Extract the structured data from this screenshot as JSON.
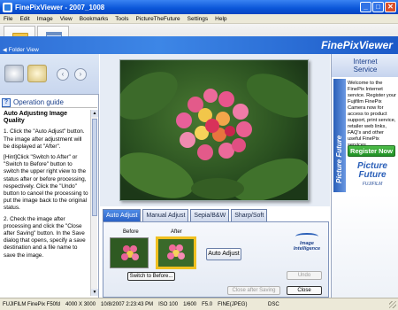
{
  "window": {
    "title": "FinePixViewer - 2007_1008",
    "min": "_",
    "max": "□",
    "close": "✕"
  },
  "menu": [
    "File",
    "Edit",
    "Image",
    "View",
    "Bookmarks",
    "Tools",
    "PictureTheFuture",
    "Settings",
    "Help"
  ],
  "banner": {
    "brand": "FinePixViewer",
    "folder_view": "Folder View"
  },
  "left_panel": {
    "back_label": "‹",
    "forward_label": "›",
    "guide_title": "Operation guide",
    "guide_icon": "?",
    "guide_heading": "Auto Adjusting Image Quality",
    "guide_paragraphs": [
      "1. Click the \"Auto Adjust\" button. The image after adjustment will be displayed at \"After\".",
      "[Hint]Click \"Switch to After\" or \"Switch to Before\" button to switch the upper right view to the status after or before processing, respectively. Click the \"Undo\" button to cancel the processing to put the image back to the original status.",
      "2. Check the image after processing and click the \"Close after Saving\" button. In the Save dialog that opens, specify a save destination and a file name to save the image."
    ]
  },
  "tabs": [
    {
      "label": "Auto Adjust",
      "active": true
    },
    {
      "label": "Manual Adjust",
      "active": false
    },
    {
      "label": "Sepia/B&W",
      "active": false
    },
    {
      "label": "Sharp/Soft",
      "active": false
    }
  ],
  "adjust_panel": {
    "before_label": "Before",
    "after_label": "After",
    "switch_button": "Switch to Before...",
    "auto_adjust_button": "Auto Adjust",
    "logo_line1": "Image",
    "logo_line2": "Intelligence",
    "undo_button": "Undo",
    "close_after_saving_button": "Close after Saving",
    "close_button": "Close"
  },
  "right_panel": {
    "service_title_line1": "Internet",
    "service_title_line2": "Service",
    "vertical_tab": "Picture Future",
    "description": "Welcome to the FinePix Internet service. Register your Fujifilm FinePix Camera now for access to product support, print service, retailer web links, FAQ's and other useful FinePix services.",
    "register_button": "Register Now",
    "logo_line1": "Picture",
    "logo_line2": "Future",
    "logo_sub": "FUJIFILM"
  },
  "status": {
    "camera": "FUJIFILM FinePix F50fd",
    "dimensions": "4000 X 3000",
    "datetime": "10/8/2007 2:23:43 PM",
    "iso": "ISO 100",
    "shutter": "1/600",
    "aperture": "F5.0",
    "quality": "FINE(JPEG)",
    "device": "DSC"
  },
  "colors": {
    "title_blue": "#0a55d8",
    "banner_blue": "#2f6fd6",
    "tab_active": "#2b62c6",
    "register_green": "#1f8f25",
    "after_frame": "#f0c020"
  },
  "icons": {
    "folder": "folder-icon",
    "window": "window-icon",
    "wand": "wand-icon",
    "stars": "stars-icon"
  }
}
